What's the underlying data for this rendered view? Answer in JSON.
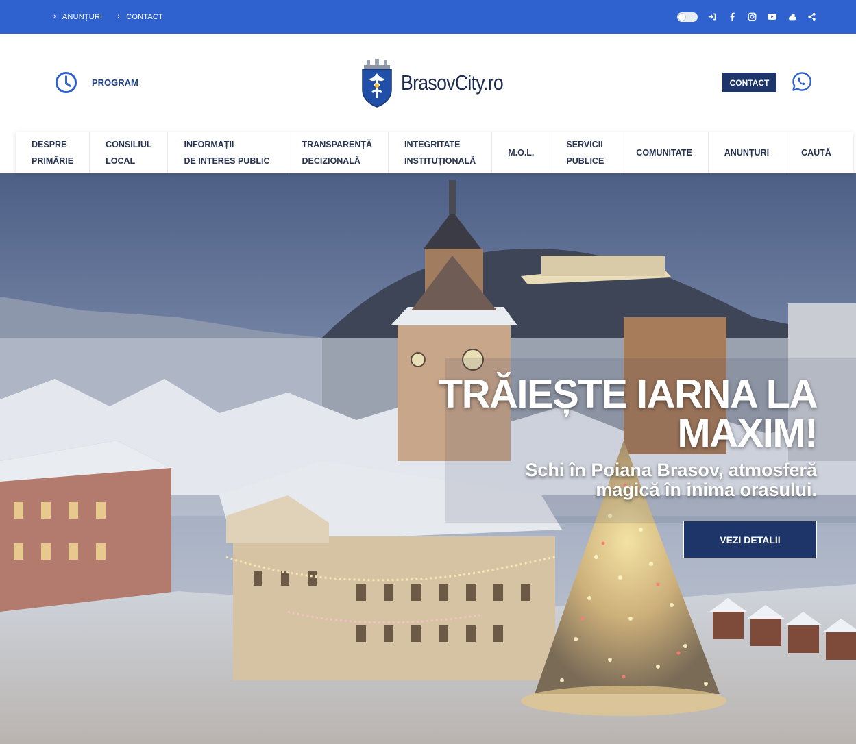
{
  "topbar": {
    "links": [
      "ANUNȚURI",
      "CONTACT"
    ],
    "icons": [
      "theme-toggle",
      "login-icon",
      "facebook-icon",
      "instagram-icon",
      "youtube-icon",
      "weather-icon",
      "share-icon"
    ],
    "background": "#2f62cf"
  },
  "header": {
    "program_label": "PROGRAM",
    "logo_text": "BrasovCity.ro",
    "contact_label": "CONTACT",
    "accent": "#1d3569"
  },
  "nav": {
    "items": [
      {
        "line1": "DESPRE",
        "line2": "PRIMĂRIE"
      },
      {
        "line1": "CONSILIUL",
        "line2": "LOCAL"
      },
      {
        "line1": "INFORMAȚII",
        "line2": "DE INTERES PUBLIC"
      },
      {
        "line1": "TRANSPARENȚĂ",
        "line2": "DECIZIONALĂ"
      },
      {
        "line1": "INTEGRITATE",
        "line2": "INSTITUȚIONALĂ"
      },
      {
        "line1": "M.O.L."
      },
      {
        "line1": "SERVICII",
        "line2": "PUBLICE"
      },
      {
        "line1": "COMUNITATE"
      },
      {
        "line1": "ANUNȚURI"
      },
      {
        "line1": "CAUTĂ"
      }
    ]
  },
  "hero": {
    "title_line1": "TRĂIEȘTE IARNA LA",
    "title_line2": "MAXIM!",
    "subtitle_line1": "Schi în Poiana Brasov, atmosferă",
    "subtitle_line2": "magică în inima orasului.",
    "cta_label": "VEZI DETALII"
  }
}
